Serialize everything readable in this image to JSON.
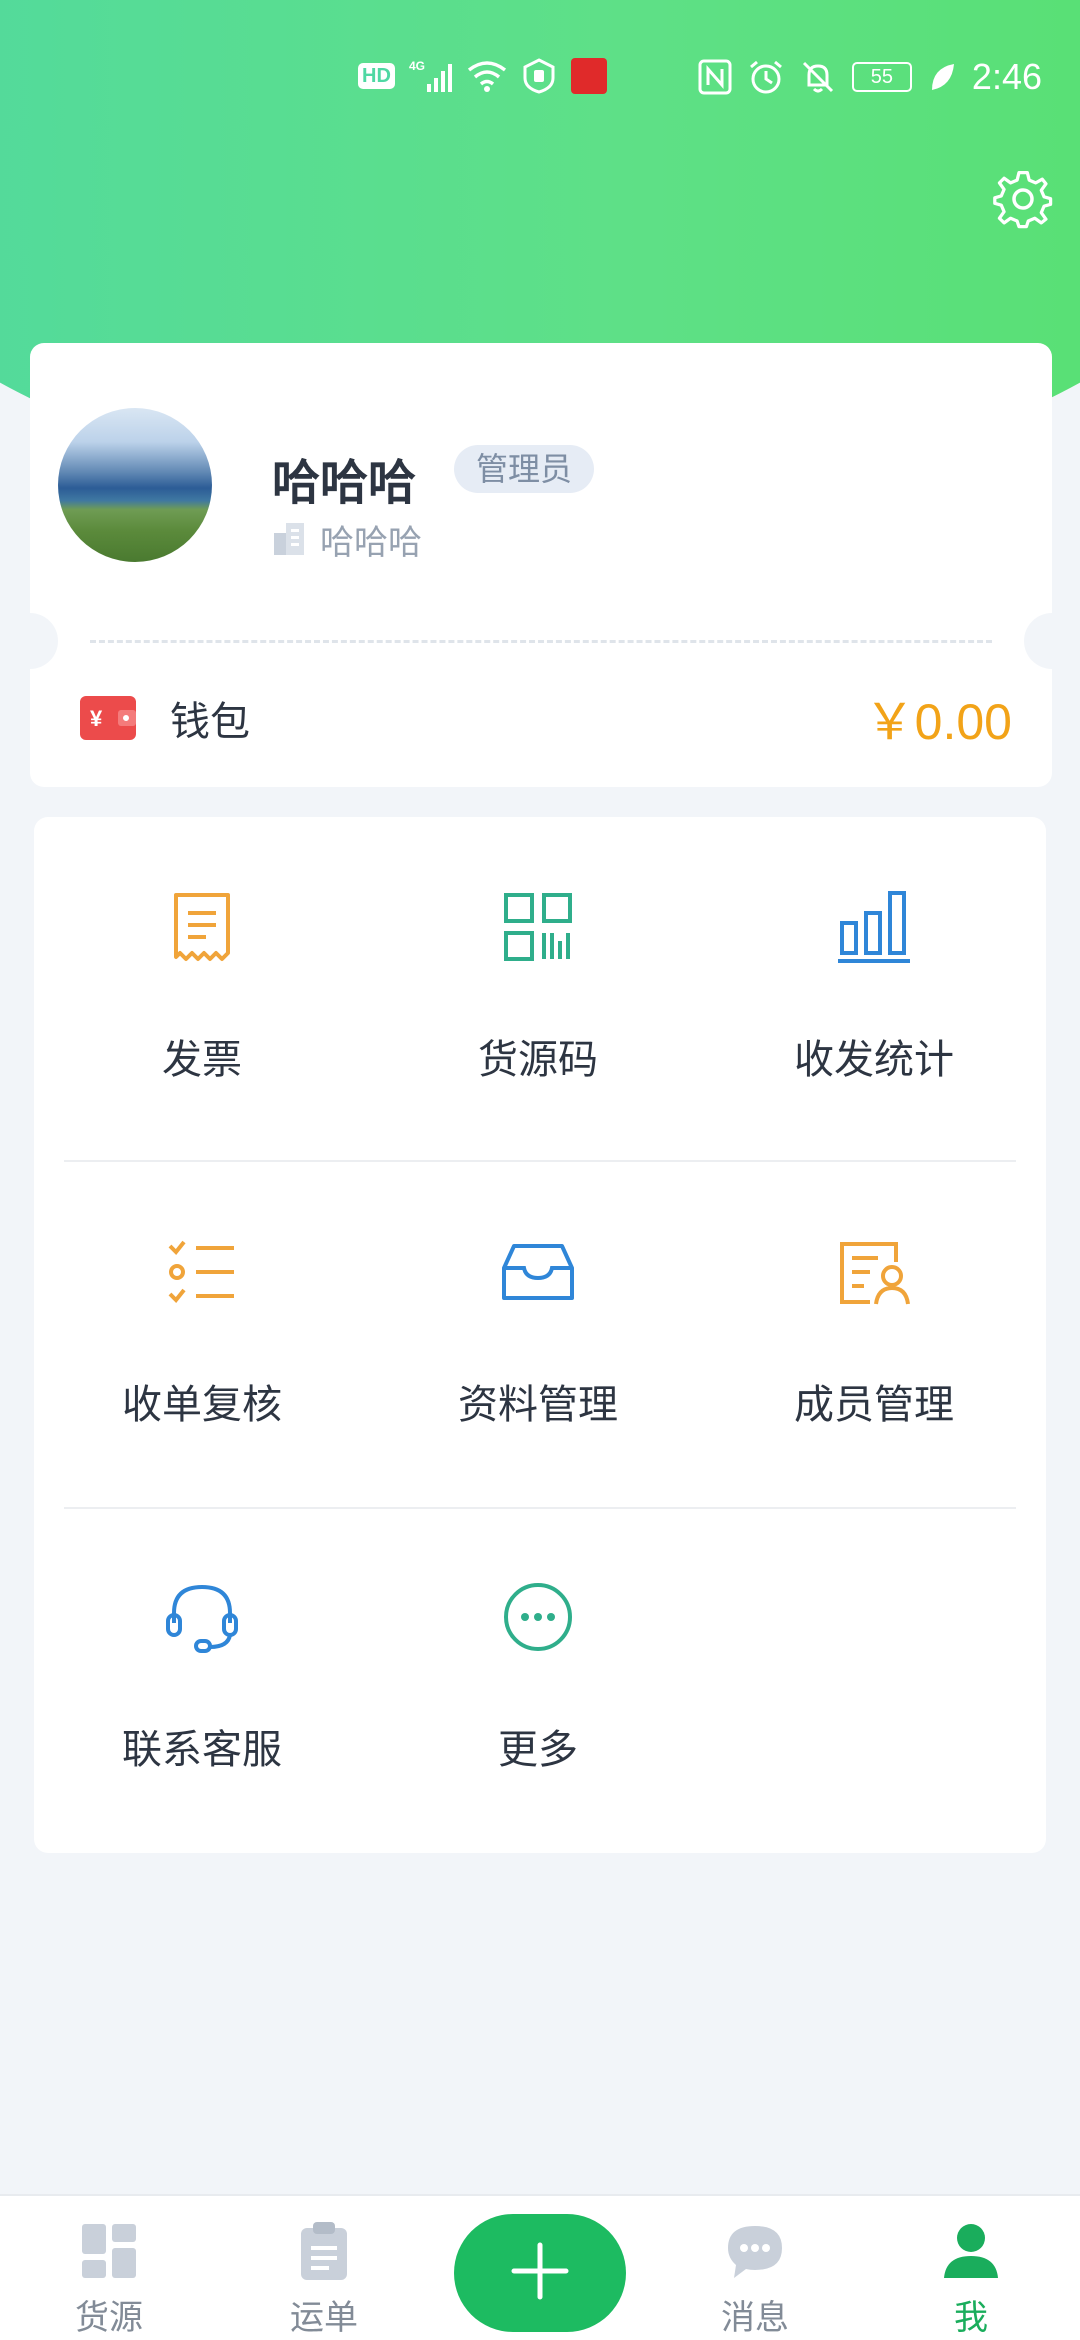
{
  "status_bar": {
    "hd": "HD",
    "network": "4G",
    "battery": "55",
    "time": "2:46"
  },
  "profile": {
    "name": "哈哈哈",
    "role": "管理员",
    "company": "哈哈哈"
  },
  "wallet": {
    "label": "钱包",
    "amount": "￥0.00",
    "icon_text": "¥"
  },
  "menu": {
    "items": [
      {
        "label": "发票",
        "icon": "invoice-icon",
        "color": "#f0a43a"
      },
      {
        "label": "货源码",
        "icon": "qr-code-icon",
        "color": "#2fae8b"
      },
      {
        "label": "收发统计",
        "icon": "bar-chart-icon",
        "color": "#2f86d8"
      },
      {
        "label": "收单复核",
        "icon": "checklist-icon",
        "color": "#f0a43a"
      },
      {
        "label": "资料管理",
        "icon": "inbox-icon",
        "color": "#2f86d8"
      },
      {
        "label": "成员管理",
        "icon": "member-card-icon",
        "color": "#f0a43a"
      },
      {
        "label": "联系客服",
        "icon": "headset-icon",
        "color": "#2f86d8"
      },
      {
        "label": "更多",
        "icon": "more-icon",
        "color": "#2fae8b"
      }
    ]
  },
  "bottom_nav": {
    "items": [
      {
        "label": "货源",
        "icon": "dashboard-icon"
      },
      {
        "label": "运单",
        "icon": "clipboard-icon"
      },
      {
        "label": "消息",
        "icon": "chat-icon"
      },
      {
        "label": "我",
        "icon": "person-icon",
        "active": true
      }
    ],
    "fab_icon": "plus-icon"
  },
  "colors": {
    "header_gradient_start": "#4fd8a3",
    "header_gradient_end": "#56e06b",
    "accent_green": "#1dbb61",
    "amount_orange": "#f2a318"
  }
}
